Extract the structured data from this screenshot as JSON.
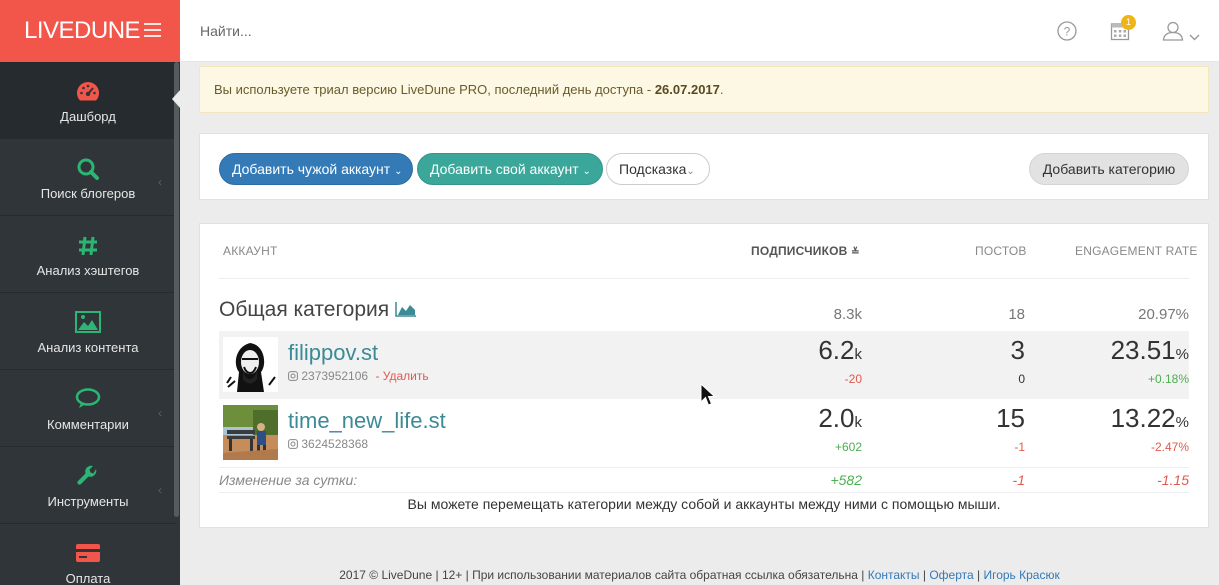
{
  "brand": {
    "name": "LIVEDUNE"
  },
  "colors": {
    "accent": "#f2554a",
    "sidebar": "#2f3539",
    "primary_blue": "#337ab7",
    "teal": "#3ba69a",
    "link": "#3b8a95",
    "positive": "#4caf50",
    "negative": "#e05a4f"
  },
  "header": {
    "search_placeholder": "Найти...",
    "calendar_badge": "1",
    "icons": [
      "help-icon",
      "calendar-icon",
      "user-icon",
      "chevron-down-icon"
    ]
  },
  "sidebar": {
    "items": [
      {
        "label": "Дашборд",
        "icon": "dashboard-icon",
        "active": true
      },
      {
        "label": "Поиск блогеров",
        "icon": "search-icon"
      },
      {
        "label": "Анализ хэштегов",
        "icon": "hashtag-icon"
      },
      {
        "label": "Анализ контента",
        "icon": "image-icon"
      },
      {
        "label": "Комментарии",
        "icon": "comments-icon"
      },
      {
        "label": "Инструменты",
        "icon": "wrench-icon"
      },
      {
        "label": "Оплата",
        "icon": "credit-card-icon"
      }
    ]
  },
  "banner": {
    "text": "Вы используете триал версию LiveDune PRO, последний день доступа - ",
    "date": "26.07.2017",
    "end": "."
  },
  "toolbar": {
    "add_other_account": "Добавить чужой аккаунт",
    "add_own_account": "Добавить свой аккаунт",
    "hint": "Подсказка",
    "add_category": "Добавить категорию"
  },
  "table": {
    "columns": {
      "account": "Аккаунт",
      "followers": "Подписчиков",
      "posts": "Постов",
      "er": "Engagement Rate"
    },
    "category": {
      "name": "Общая категория",
      "followers": "8.3k",
      "posts": "18",
      "er": "20.97%"
    },
    "accounts": [
      {
        "name": "filippov.st",
        "id": "2373952106",
        "delete": "- Удалить",
        "followers": "6.2",
        "followers_unit": "k",
        "followers_delta": "-20",
        "posts": "3",
        "posts_delta": "0",
        "er": "23.51",
        "er_unit": "%",
        "er_delta": "+0.18%"
      },
      {
        "name": "time_new_life.st",
        "id": "3624528368",
        "followers": "2.0",
        "followers_unit": "k",
        "followers_delta": "+602",
        "posts": "15",
        "posts_delta": "-1",
        "er": "13.22",
        "er_unit": "%",
        "er_delta": "-2.47%"
      }
    ],
    "daily_change": {
      "label": "Изменение за сутки:",
      "followers": "+582",
      "posts": "-1",
      "er": "-1.15"
    },
    "hint": "Вы можете перемещать категории между собой и аккаунты между ними с помощью мыши."
  },
  "footer": {
    "text": "2017 © LiveDune | 12+ | При использовании материалов сайта обратная ссылка обязательна | ",
    "links": [
      "Контакты",
      "Оферта",
      "Игорь Красюк"
    ],
    "sep": " | "
  }
}
